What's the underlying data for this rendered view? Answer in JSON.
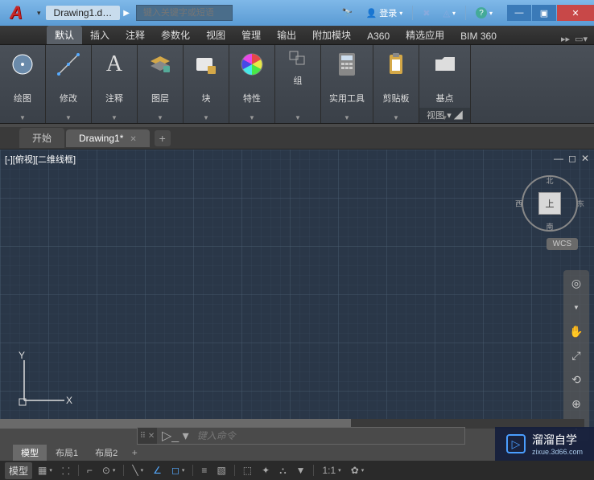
{
  "title": {
    "document": "Drawing1.d…",
    "search_placeholder": "键入关键字或短语",
    "login": "登录",
    "help": "?"
  },
  "ribbon": {
    "tabs": [
      "默认",
      "插入",
      "注释",
      "参数化",
      "视图",
      "管理",
      "输出",
      "附加模块",
      "A360",
      "精选应用",
      "BIM 360"
    ],
    "active": 0,
    "panels": {
      "draw": "绘图",
      "modify": "修改",
      "annotate": "注释",
      "layer": "图层",
      "block": "块",
      "properties": "特性",
      "group": "组",
      "utils": "实用工具",
      "clipboard": "剪贴板",
      "base": "基点",
      "view_footer": "视图"
    }
  },
  "doctabs": {
    "start": "开始",
    "drawing": "Drawing1*"
  },
  "viewport": {
    "label": "[-][俯视][二维线框]",
    "cube_face": "上",
    "compass": {
      "n": "北",
      "s": "南",
      "e": "东",
      "w": "西"
    },
    "wcs": "WCS"
  },
  "ucs": {
    "x": "X",
    "y": "Y"
  },
  "cmdline": {
    "placeholder": "键入命令"
  },
  "layouts": {
    "model": "模型",
    "layout1": "布局1",
    "layout2": "布局2"
  },
  "status": {
    "model": "模型",
    "scale": "1:1"
  },
  "watermark": {
    "text": "溜溜自学",
    "url": "zixue.3d66.com"
  }
}
